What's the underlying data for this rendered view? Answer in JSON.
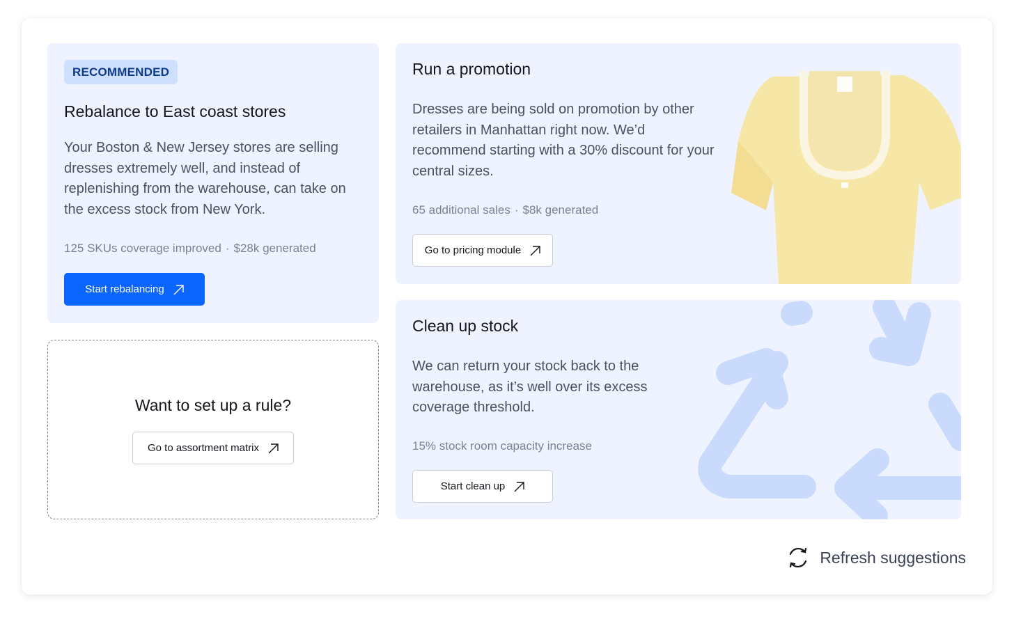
{
  "recommended_card": {
    "badge": "RECOMMENDED",
    "title": "Rebalance to East coast stores",
    "body": "Your Boston & New Jersey stores are selling dresses extremely well, and instead of replenishing from the warehouse, can take on the excess stock from New York.",
    "stat_1": "125 SKUs coverage improved",
    "stat_2": "$28k generated",
    "button_label": "Start rebalancing"
  },
  "rule_card": {
    "title": "Want to set up a rule?",
    "button_label": "Go to assortment matrix"
  },
  "promotion_card": {
    "title": "Run a promotion",
    "body": "Dresses are being sold on promotion by other retailers in Manhattan right now. We’d recommend starting with a 30% discount for your central sizes.",
    "stat_1": "65 additional sales",
    "stat_2": "$8k generated",
    "button_label": "Go to pricing module"
  },
  "cleanup_card": {
    "title": "Clean up stock",
    "body": "We can return your stock back to the warehouse, as it’s well over its excess coverage threshold.",
    "stat_1": "15% stock room capacity increase",
    "button_label": "Start clean up"
  },
  "footer": {
    "refresh_label": "Refresh suggestions"
  },
  "icons": {
    "button_arrow": "arrow-up-right-icon",
    "refresh": "refresh-icon",
    "promotion_image": "yellow-top-garment",
    "cleanup_image": "recycle-arrows"
  },
  "colors": {
    "primary": "#0a66ff",
    "card_bg": "#eef3ff",
    "badge_bg": "#cfe0ff",
    "badge_text": "#0d3a8a",
    "recycle": "#c9dafc",
    "garment": "#f7e7a6"
  }
}
